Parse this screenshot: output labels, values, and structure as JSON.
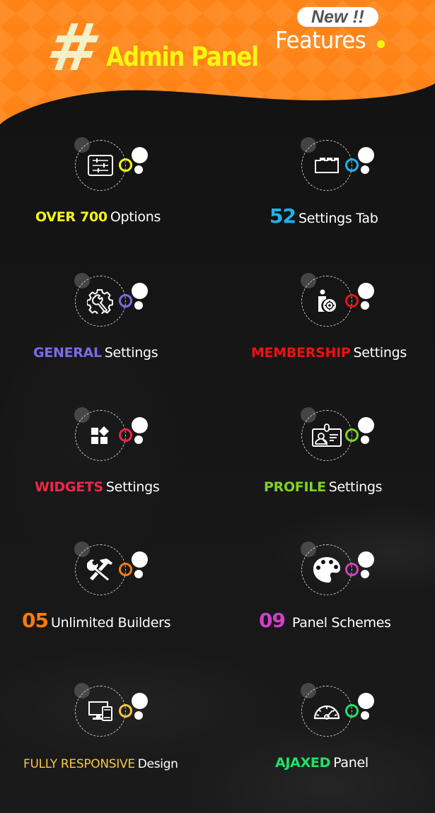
{
  "header": {
    "hash": "#",
    "title": "Admin Panel",
    "badge": "New !!",
    "subtitle": "Features",
    "colors": {
      "background": "#ff7f0f",
      "hash": "#f4f0c8",
      "title": "#f4f713",
      "badge_text": "#555555"
    }
  },
  "features": [
    {
      "highlight": "OVER 700",
      "text": "Options",
      "color": "#f4f713",
      "icon": "sliders-icon"
    },
    {
      "highlight": "52",
      "text": "Settings Tab",
      "color": "#1fb2ec",
      "icon": "tab-folder-icon"
    },
    {
      "highlight": "GENERAL",
      "text": "Settings",
      "color": "#7a6bee",
      "icon": "gear-wrench-icon"
    },
    {
      "highlight": "MEMBERSHIP",
      "text": "Settings",
      "color": "#ee1111",
      "icon": "user-settings-icon"
    },
    {
      "highlight": "WIDGETS",
      "text": "Settings",
      "color": "#f3244a",
      "icon": "widgets-icon"
    },
    {
      "highlight": "PROFILE",
      "text": "Settings",
      "color": "#7ed321",
      "icon": "id-card-icon"
    },
    {
      "highlight": "05",
      "text": "Unlimited Builders",
      "color": "#ff7a0a",
      "icon": "tools-icon"
    },
    {
      "highlight": "09",
      "text": "Panel Schemes",
      "color": "#d03fc4",
      "icon": "palette-icon"
    },
    {
      "highlight": "FULLY RESPONSIVE",
      "text": "Design",
      "color": "#f8c640",
      "icon": "devices-icon"
    },
    {
      "highlight": "AJAXED",
      "text": "Panel",
      "color": "#1ee26a",
      "icon": "speedometer-icon"
    }
  ]
}
